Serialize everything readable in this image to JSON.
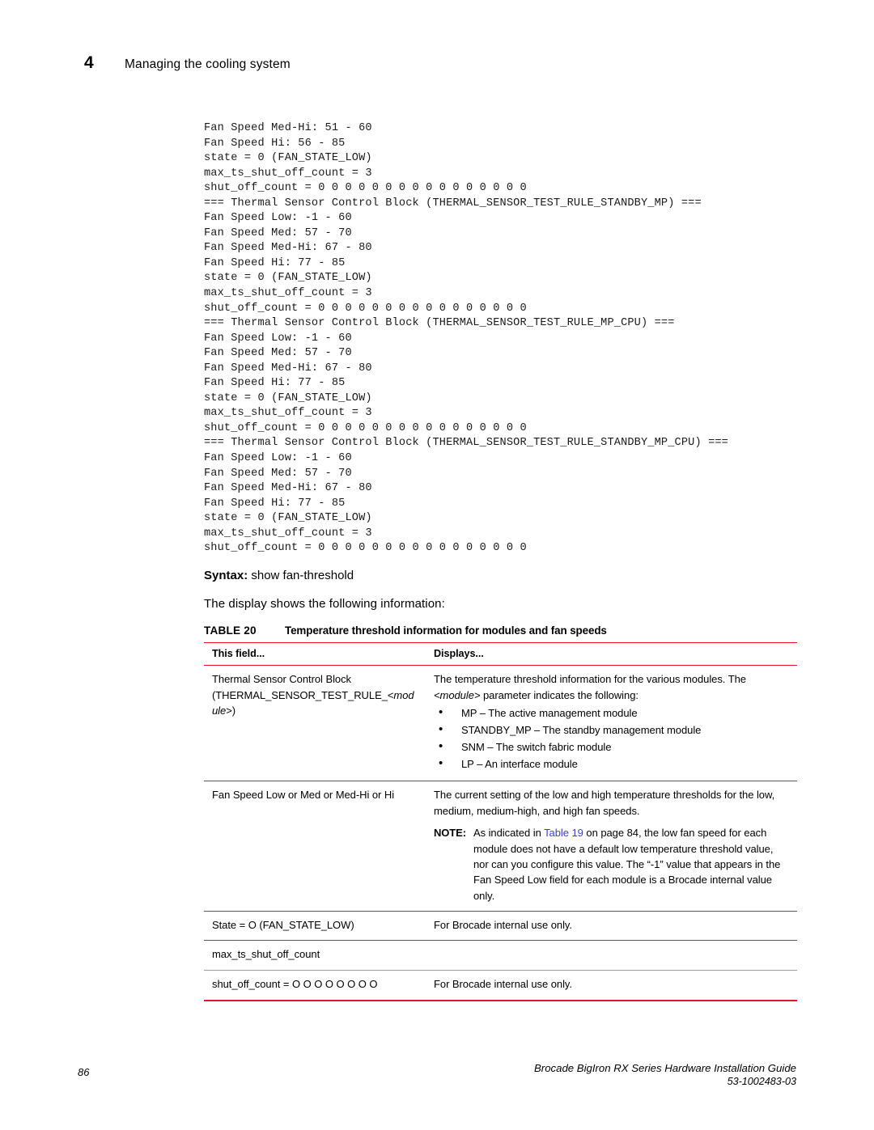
{
  "header": {
    "chapter_number": "4",
    "chapter_title": "Managing the cooling system"
  },
  "code_block": {
    "lines": [
      "Fan Speed Med-Hi: 51 - 60",
      "Fan Speed Hi: 56 - 85",
      "state = 0 (FAN_STATE_LOW)",
      "max_ts_shut_off_count = 3",
      "shut_off_count = 0 0 0 0 0 0 0 0 0 0 0 0 0 0 0 0",
      "=== Thermal Sensor Control Block (THERMAL_SENSOR_TEST_RULE_STANDBY_MP) ===",
      "Fan Speed Low: -1 - 60",
      "Fan Speed Med: 57 - 70",
      "Fan Speed Med-Hi: 67 - 80",
      "Fan Speed Hi: 77 - 85",
      "state = 0 (FAN_STATE_LOW)",
      "max_ts_shut_off_count = 3",
      "shut_off_count = 0 0 0 0 0 0 0 0 0 0 0 0 0 0 0 0",
      "=== Thermal Sensor Control Block (THERMAL_SENSOR_TEST_RULE_MP_CPU) ===",
      "Fan Speed Low: -1 - 60",
      "Fan Speed Med: 57 - 70",
      "Fan Speed Med-Hi: 67 - 80",
      "Fan Speed Hi: 77 - 85",
      "state = 0 (FAN_STATE_LOW)",
      "max_ts_shut_off_count = 3",
      "shut_off_count = 0 0 0 0 0 0 0 0 0 0 0 0 0 0 0 0",
      "=== Thermal Sensor Control Block (THERMAL_SENSOR_TEST_RULE_STANDBY_MP_CPU) ===",
      "Fan Speed Low: -1 - 60",
      "Fan Speed Med: 57 - 70",
      "Fan Speed Med-Hi: 67 - 80",
      "Fan Speed Hi: 77 - 85",
      "state = 0 (FAN_STATE_LOW)",
      "max_ts_shut_off_count = 3",
      "shut_off_count = 0 0 0 0 0 0 0 0 0 0 0 0 0 0 0 0"
    ]
  },
  "syntax": {
    "label": "Syntax:",
    "command": "show fan-threshold"
  },
  "intro_text": "The display shows the following information:",
  "table": {
    "caption_number": "TABLE 20",
    "caption_text": "Temperature threshold information for modules and fan speeds",
    "rule_color": "#e8112d",
    "link_color": "#3b3bd8",
    "columns": [
      "This field...",
      "Displays..."
    ],
    "rows": [
      {
        "field_pre": "Thermal Sensor Control Block (THERMAL_SENSOR_TEST_RULE_<",
        "field_italic": "mod ule",
        "field_post": ">)",
        "displays_intro_pre": "The temperature threshold information for the various modules. The ",
        "displays_intro_italic": "<module>",
        "displays_intro_post": " parameter indicates the following:",
        "bullets": [
          "MP – The active management module",
          "STANDBY_MP – The standby management module",
          "SNM – The switch fabric module",
          "LP – An interface module"
        ]
      },
      {
        "field": "Fan Speed Low or Med or Med-Hi or Hi",
        "displays_intro": "The current setting of the low and high temperature thresholds for the low, medium, medium-high, and high fan speeds.",
        "note_label": "NOTE:",
        "note_pre": "As indicated in ",
        "note_link": "Table 19",
        "note_post": " on page 84, the low fan speed for each module does not have a default low temperature threshold value, nor can you configure this value. The “-1” value that appears in the Fan Speed Low field for each module is a Brocade internal value only."
      },
      {
        "field": "State = O (FAN_STATE_LOW)",
        "displays": "For Brocade internal use only."
      },
      {
        "field": "max_ts_shut_off_count",
        "displays": ""
      },
      {
        "field": "shut_off_count = O O O O O O O O",
        "displays": "For Brocade internal use only."
      }
    ]
  },
  "footer": {
    "page_number": "86",
    "guide_title": "Brocade BigIron RX Series Hardware Installation Guide",
    "document_id": "53-1002483-03"
  }
}
